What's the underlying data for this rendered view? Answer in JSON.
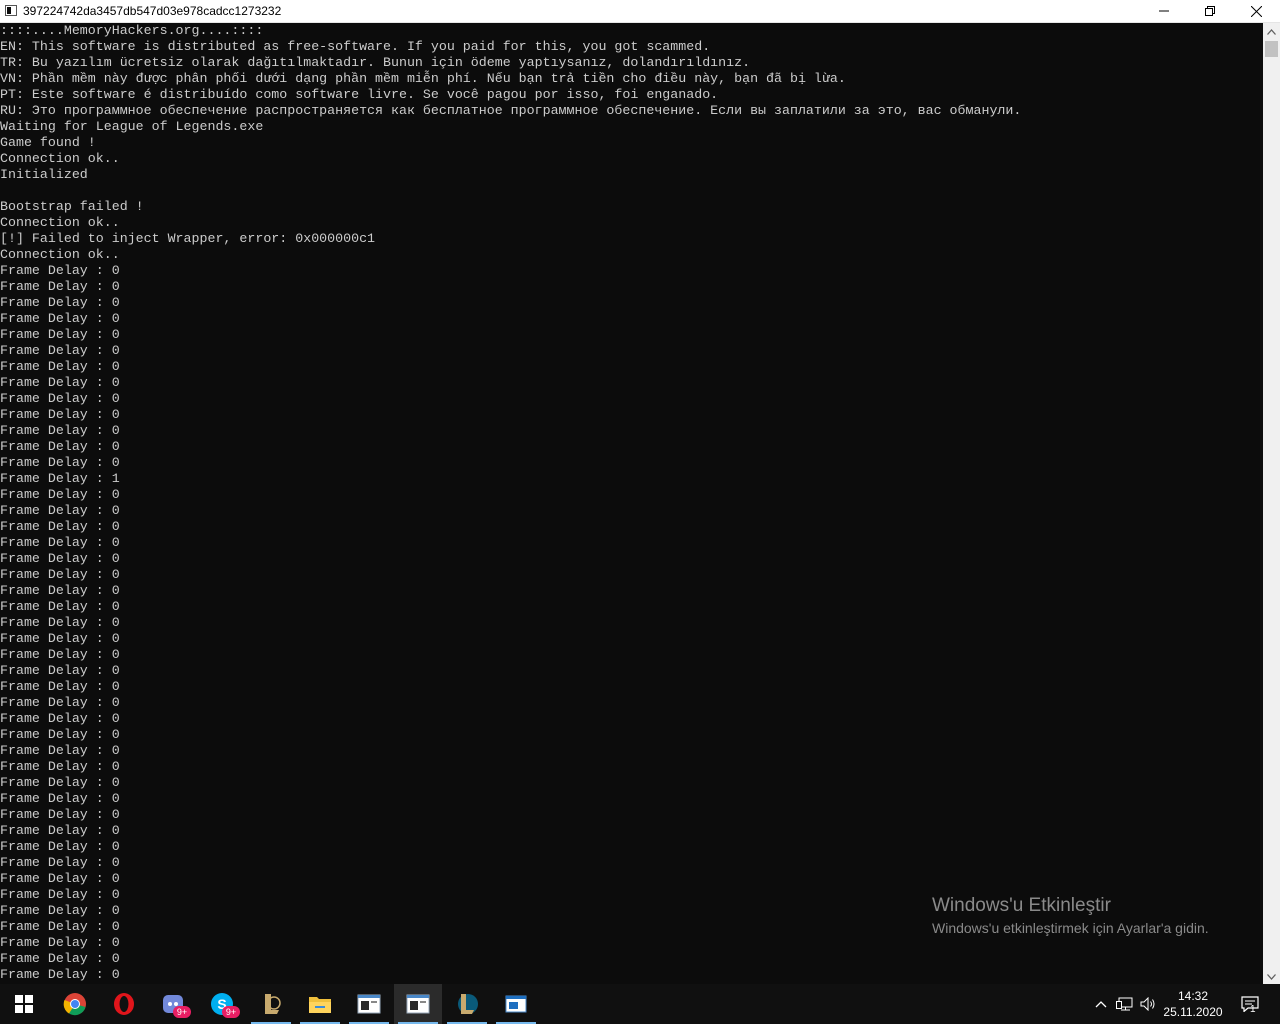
{
  "window": {
    "title": "397224742da3457db547d03e978cadcc1273232"
  },
  "console": {
    "lines": [
      "::::....MemoryHackers.org....::::",
      "EN: This software is distributed as free-software. If you paid for this, you got scammed.",
      "TR: Bu yazılım ücretsiz olarak dağıtılmaktadır. Bunun için ödeme yaptıysanız, dolandırıldınız.",
      "VN: Phần mềm này được phân phối dưới dạng phần mềm miễn phí. Nếu bạn trả tiền cho điều này, bạn đã bị lừa.",
      "PT: Este software é distribuído como software livre. Se você pagou por isso, foi enganado.",
      "RU: Это программное обеспечение распространяется как бесплатное программное обеспечение. Если вы заплатили за это, вас обманули.",
      "Waiting for League of Legends.exe",
      "Game found !",
      "Connection ok..",
      "Initialized",
      "",
      "Bootstrap failed !",
      "Connection ok..",
      "[!] Failed to inject Wrapper, error: 0x000000c1",
      "Connection ok..",
      "Frame Delay : 0",
      "Frame Delay : 0",
      "Frame Delay : 0",
      "Frame Delay : 0",
      "Frame Delay : 0",
      "Frame Delay : 0",
      "Frame Delay : 0",
      "Frame Delay : 0",
      "Frame Delay : 0",
      "Frame Delay : 0",
      "Frame Delay : 0",
      "Frame Delay : 0",
      "Frame Delay : 0",
      "Frame Delay : 1",
      "Frame Delay : 0",
      "Frame Delay : 0",
      "Frame Delay : 0",
      "Frame Delay : 0",
      "Frame Delay : 0",
      "Frame Delay : 0",
      "Frame Delay : 0",
      "Frame Delay : 0",
      "Frame Delay : 0",
      "Frame Delay : 0",
      "Frame Delay : 0",
      "Frame Delay : 0",
      "Frame Delay : 0",
      "Frame Delay : 0",
      "Frame Delay : 0",
      "Frame Delay : 0",
      "Frame Delay : 0",
      "Frame Delay : 0",
      "Frame Delay : 0",
      "Frame Delay : 0",
      "Frame Delay : 0",
      "Frame Delay : 0",
      "Frame Delay : 0",
      "Frame Delay : 0",
      "Frame Delay : 0",
      "Frame Delay : 0",
      "Frame Delay : 0",
      "Frame Delay : 0",
      "Frame Delay : 0",
      "Frame Delay : 0",
      "Frame Delay : 0"
    ]
  },
  "watermark": {
    "title": "Windows'u Etkinleştir",
    "subtitle": "Windows'u etkinleştirmek için Ayarlar'a gidin."
  },
  "taskbar": {
    "apps": [
      {
        "icon": "windows-start-icon",
        "active": false
      },
      {
        "icon": "chrome-icon",
        "active": false
      },
      {
        "icon": "opera-icon",
        "active": false
      },
      {
        "icon": "discord-icon",
        "badge": "9+",
        "active": false
      },
      {
        "icon": "skype-icon",
        "badge": "9+",
        "active": false
      },
      {
        "icon": "league-client-icon",
        "active": false
      },
      {
        "icon": "file-explorer-icon",
        "active": false
      },
      {
        "icon": "console-window-icon",
        "active": false
      },
      {
        "icon": "console-window-icon",
        "active": true
      },
      {
        "icon": "league-of-legends-icon",
        "active": false
      },
      {
        "icon": "app-window-icon",
        "active": false
      }
    ],
    "clock": {
      "time": "14:32",
      "date": "25.11.2020"
    },
    "notification_count": "1"
  },
  "colors": {
    "console_bg": "#0c0c0c",
    "console_text": "#cccccc",
    "taskbar_bg": "#101010",
    "accent": "#76b9ed"
  }
}
